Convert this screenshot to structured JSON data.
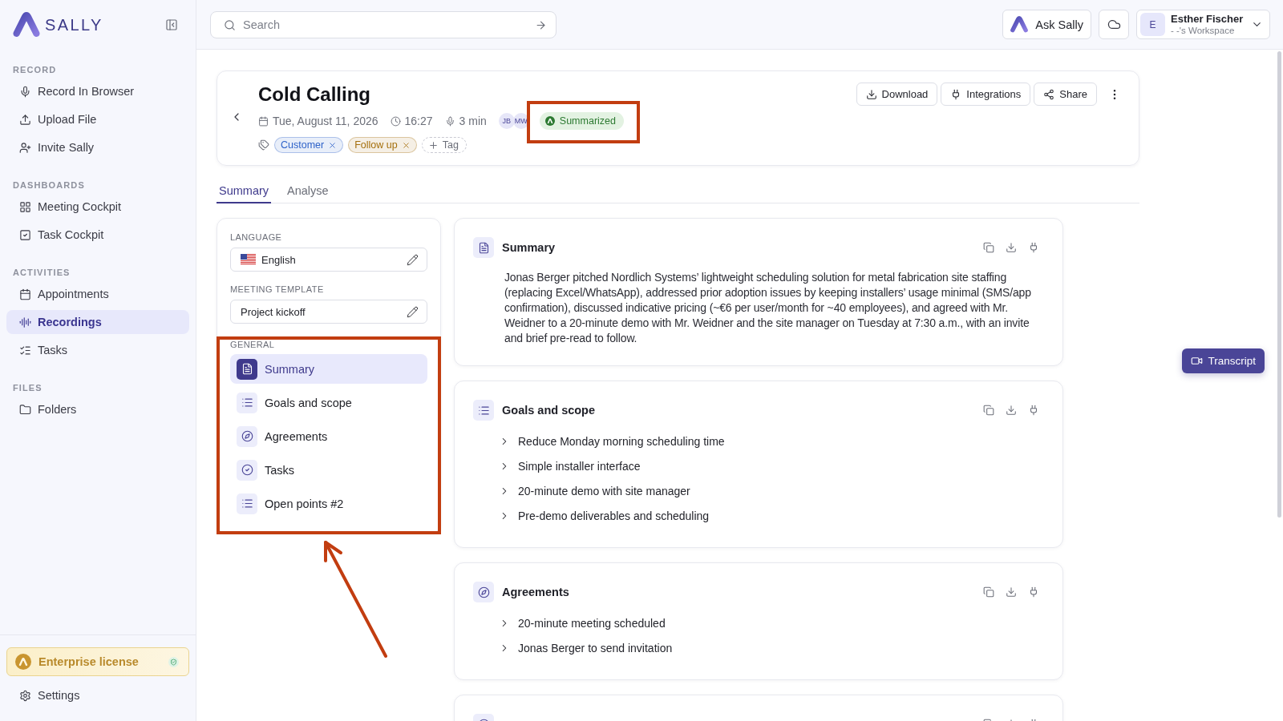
{
  "sidebar": {
    "logo": "SALLY",
    "sections": [
      {
        "title": "RECORD",
        "items": [
          {
            "label": "Record In Browser",
            "selected": false
          },
          {
            "label": "Upload File",
            "selected": false
          },
          {
            "label": "Invite Sally",
            "selected": false
          }
        ]
      },
      {
        "title": "DASHBOARDS",
        "items": [
          {
            "label": "Meeting Cockpit",
            "selected": false
          },
          {
            "label": "Task Cockpit",
            "selected": false
          }
        ]
      },
      {
        "title": "ACTIVITIES",
        "items": [
          {
            "label": "Appointments",
            "selected": false
          },
          {
            "label": "Recordings",
            "selected": true
          },
          {
            "label": "Tasks",
            "selected": false
          }
        ]
      },
      {
        "title": "FILES",
        "items": [
          {
            "label": "Folders",
            "selected": false
          }
        ]
      }
    ],
    "license": "Enterprise license",
    "settings": "Settings"
  },
  "topbar": {
    "search": {
      "placeholder": "Search"
    },
    "ask_button": "Ask Sally",
    "user": {
      "initial": "E",
      "name": "Esther Fischer",
      "workspace": "- -'s Workspace"
    }
  },
  "meeting": {
    "title": "Cold Calling",
    "date": "Tue, August 11, 2026",
    "time": "16:27",
    "duration": "3 min",
    "participants": [
      "JB",
      "MW"
    ],
    "status": "Summarized",
    "tags": [
      {
        "label": "Customer",
        "color": "#2f63c9"
      },
      {
        "label": "Follow up",
        "color": "#a5700e"
      }
    ],
    "add_tag": "Tag",
    "actions": [
      "Download",
      "Integrations",
      "Share"
    ]
  },
  "tabs": [
    {
      "label": "Summary",
      "selected": true
    },
    {
      "label": "Analyse",
      "selected": false
    }
  ],
  "template_panel": {
    "language": {
      "label": "LANGUAGE",
      "value": "English"
    },
    "template": {
      "label": "MEETING TEMPLATE",
      "value": "Project kickoff"
    },
    "group": "GENERAL",
    "items": [
      {
        "label": "Summary",
        "selected": true
      },
      {
        "label": "Goals and scope",
        "selected": false
      },
      {
        "label": "Agreements",
        "selected": false
      },
      {
        "label": "Tasks",
        "selected": false
      },
      {
        "label": "Open points #2",
        "selected": false
      }
    ]
  },
  "sections": [
    {
      "kind": "text",
      "title": "Summary",
      "text": "Jonas Berger pitched Nordlich Systems’ lightweight scheduling solution for metal fabrication site staffing (replacing Excel/WhatsApp), addressed prior adoption issues by keeping installers’ usage minimal (SMS/app confirmation), discussed indicative pricing (~€6 per user/month for ~40 employees), and agreed with Mr. Weidner to a 20-minute demo with Mr. Weidner and the site manager on Tuesday at 7:30 a.m., with an invite and brief pre-read to follow."
    },
    {
      "kind": "list",
      "title": "Goals and scope",
      "items": [
        "Reduce Monday morning scheduling time",
        "Simple installer interface",
        "20-minute demo with site manager",
        "Pre-demo deliverables and scheduling"
      ]
    },
    {
      "kind": "list",
      "title": "Agreements",
      "items": [
        "20-minute meeting scheduled",
        "Jonas Berger to send invitation"
      ]
    },
    {
      "kind": "partial"
    }
  ],
  "transcript_button": "Transcript"
}
